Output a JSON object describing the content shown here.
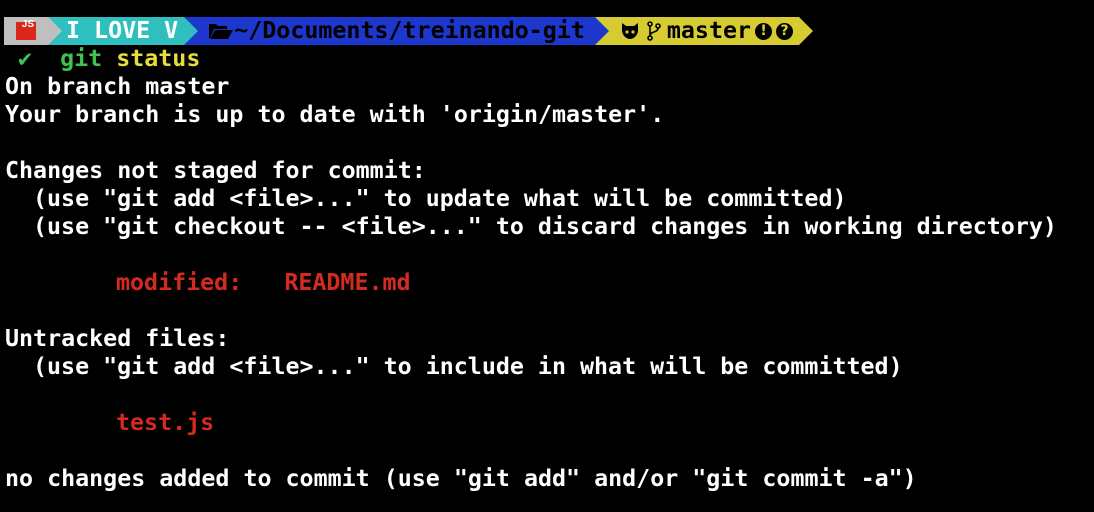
{
  "colors": {
    "background": "#000000",
    "text": "#ffffff",
    "js_segment": "#bfbfbf",
    "love_segment": "#2fbfbf",
    "path_segment": "#1d36cc",
    "git_segment": "#d6cc32",
    "modified": "#d42b21",
    "success": "#3fc24f",
    "command_arg": "#e6dd3c"
  },
  "prompt": {
    "js_badge": "JS",
    "love_text": "I LOVE V",
    "folder_icon": "folder-open-icon",
    "path": "~/Documents/treinando-git",
    "git_icon": "github-cat-icon",
    "branch_icon": "git-branch-icon",
    "branch": "master",
    "status_icons": [
      "!",
      "?"
    ]
  },
  "command": {
    "status_icon": "✔",
    "name": "git",
    "arg": "status"
  },
  "output": {
    "line1": "On branch master",
    "line2": "Your branch is up to date with 'origin/master'.",
    "not_staged_header": "Changes not staged for commit:",
    "hint_add": "(use \"git add <file>...\" to update what will be committed)",
    "hint_checkout": "(use \"git checkout -- <file>...\" to discard changes in working directory)",
    "modified_label": "modified:",
    "modified_file": "README.md",
    "untracked_header": "Untracked files:",
    "hint_include": "(use \"git add <file>...\" to include in what will be committed)",
    "untracked_file": "test.js",
    "footer": "no changes added to commit (use \"git add\" and/or \"git commit -a\")"
  }
}
